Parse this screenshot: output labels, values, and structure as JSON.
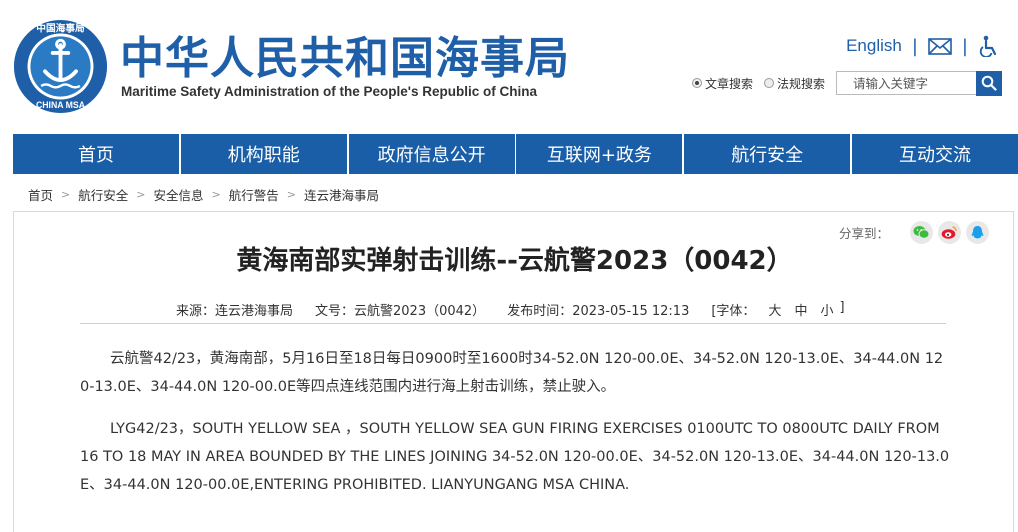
{
  "header": {
    "title_cn": "中华人民共和国海事局",
    "title_en": "Maritime Safety Administration of the People's Republic of China",
    "logo_text_cn": "中国海事局",
    "logo_text_en": "CHINA MSA",
    "english_link": "English",
    "separator": "|",
    "icons": [
      "mail-icon",
      "accessibility-icon",
      "search-icon"
    ],
    "brand_color": "#1f5fa8"
  },
  "search": {
    "option_article": "文章搜索",
    "option_law": "法规搜索",
    "selected": "文章搜索",
    "placeholder": "请输入关键字"
  },
  "nav": {
    "items": [
      {
        "label": "首页"
      },
      {
        "label": "机构职能"
      },
      {
        "label": "政府信息公开"
      },
      {
        "label": "互联网+政务"
      },
      {
        "label": "航行安全"
      },
      {
        "label": "互动交流"
      }
    ],
    "color": "#1a5ea8"
  },
  "breadcrumb": {
    "items": [
      "首页",
      "航行安全",
      "安全信息",
      "航行警告",
      "连云港海事局"
    ],
    "separator": ">"
  },
  "share": {
    "label": "分享到：",
    "icons": [
      "wechat-icon",
      "weibo-icon",
      "qq-icon"
    ]
  },
  "article": {
    "title": "黄海南部实弹射击训练--云航警2023（0042）",
    "source": "来源：连云港海事局",
    "doc_no": "文号：云航警2023（0042）",
    "publish_time": "发布时间：2023-05-15 12:13",
    "font_label": "[字体：",
    "font_large": "大",
    "font_medium": "中",
    "font_small": "小",
    "font_close": "]",
    "para_cn": "云航警42/23，黄海南部，5月16日至18日每日0900时至1600时34-52.0N 120-00.0E、34-52.0N 120-13.0E、34-44.0N 120-13.0E、34-44.0N 120-00.0E等四点连线范围内进行海上射击训练，禁止驶入。",
    "para_en": "LYG42/23，SOUTH YELLOW SEA ，SOUTH YELLOW SEA GUN FIRING EXERCISES 0100UTC TO 0800UTC DAILY FROM 16 TO 18 MAY IN AREA BOUNDED BY THE LINES JOINING 34-52.0N 120-00.0E、34-52.0N 120-13.0E、34-44.0N 120-13.0E、34-44.0N 120-00.0E,ENTERING PROHIBITED. LIANYUNGANG MSA CHINA."
  }
}
